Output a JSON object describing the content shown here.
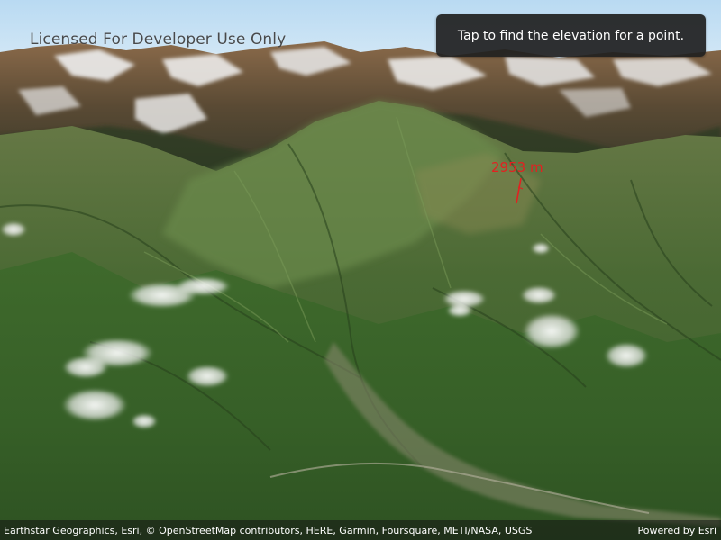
{
  "map_view": {
    "watermark": "Licensed For Developer Use Only",
    "instruction": "Tap to find the elevation for a point.",
    "elevation_result": {
      "text": "2953 m",
      "color": "#e22121"
    },
    "attribution": "Earthstar Geographics, Esri, © OpenStreetMap contributors, HERE, Garmin, Foursquare, METI/NASA, USGS",
    "powered_by": "Powered by Esri"
  },
  "colors": {
    "sky": "#cfe6f7",
    "forest": "#3f6a2c",
    "snow": "#f2f2f2",
    "panel": "#202020",
    "marker": "#e22121"
  }
}
